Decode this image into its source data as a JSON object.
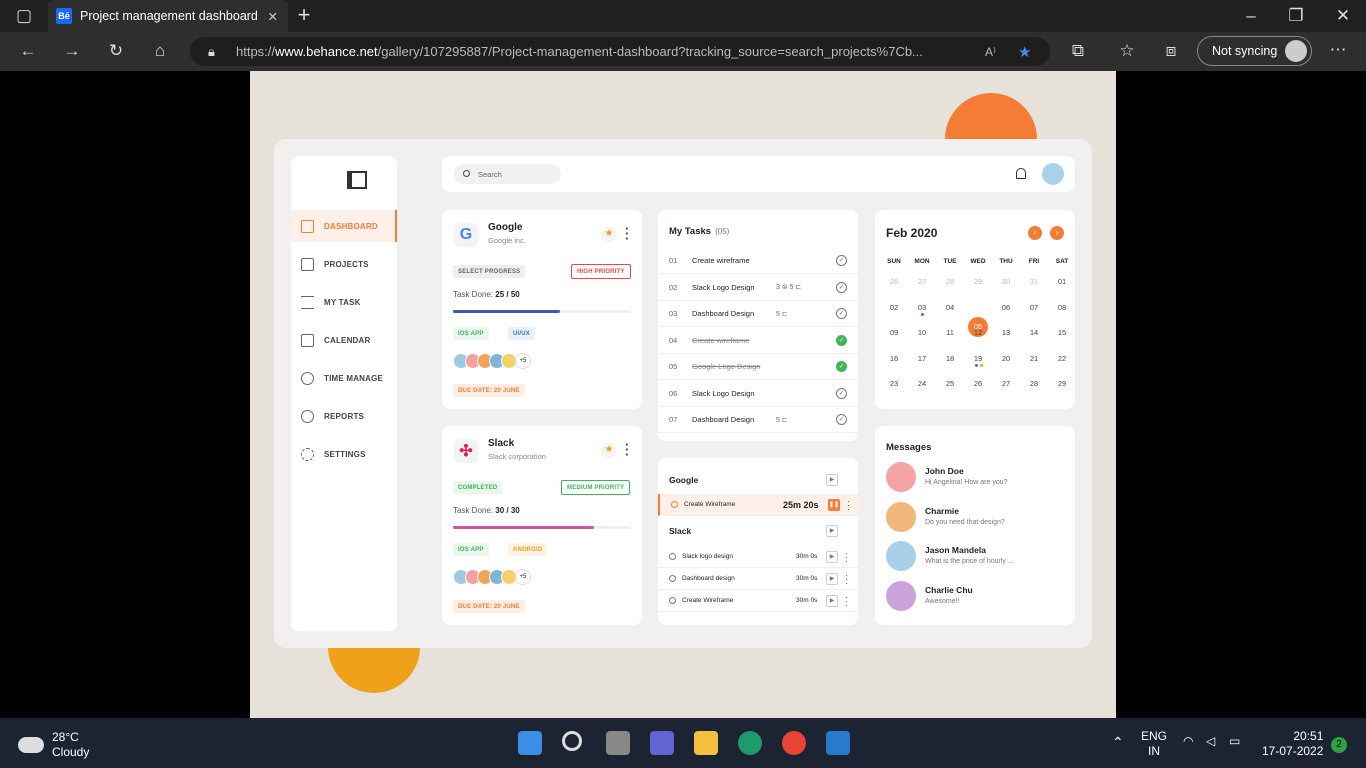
{
  "browser": {
    "tab_title": "Project management dashboard",
    "tab_icon": "Bē",
    "url_prefix": "https://",
    "url_domain": "www.behance.net",
    "url_rest": "/gallery/107295887/Project-management-dashboard?tracking_source=search_projects%7Cb...",
    "sync_label": "Not syncing"
  },
  "sidebar": {
    "items": [
      {
        "label": "DASHBOARD",
        "active": true
      },
      {
        "label": "PROJECTS"
      },
      {
        "label": "MY TASK"
      },
      {
        "label": "CALENDAR"
      },
      {
        "label": "TIME MANAGE"
      },
      {
        "label": "REPORTS"
      },
      {
        "label": "SETTINGS"
      }
    ]
  },
  "topbar": {
    "search_placeholder": "Search"
  },
  "projects": [
    {
      "name": "Google",
      "company": "Google inc.",
      "status": "SELECT PROGRESS",
      "priority": "HIGH PRIORITY",
      "task_done_label": "Task Done:",
      "task_done": "25 / 50",
      "progress": 0.6,
      "tags": [
        "IOS APP",
        "UI/UX"
      ],
      "more": "+5",
      "due": "DUE DATE: 20 JUNE"
    },
    {
      "name": "Slack",
      "company": "Slack corporation",
      "status": "COMPLETED",
      "priority": "MEDIUM PRIORITY",
      "task_done_label": "Task Done:",
      "task_done": "30 / 30",
      "progress": 0.79,
      "tags": [
        "IOS APP",
        "ANDROID"
      ],
      "more": "+5",
      "due": "DUE DATE: 20 JUNE"
    }
  ],
  "my_tasks": {
    "title": "My Tasks",
    "count": "(05)",
    "rows": [
      {
        "num": "01",
        "title": "Create wireframe",
        "meta": "",
        "done": false
      },
      {
        "num": "02",
        "title": "Slack Logo Design",
        "meta": "3 ⊜   5 ⊏",
        "done": false
      },
      {
        "num": "03",
        "title": "Dashboard Design",
        "meta": "5 ⊏",
        "done": false
      },
      {
        "num": "04",
        "title": "Create wireframe",
        "meta": "",
        "done": true
      },
      {
        "num": "05",
        "title": "Google Logo Design",
        "meta": "",
        "done": true
      },
      {
        "num": "06",
        "title": "Slack Logo Design",
        "meta": "",
        "done": false
      },
      {
        "num": "07",
        "title": "Dashboard Design",
        "meta": "5 ⊏",
        "done": false
      }
    ]
  },
  "timer": {
    "group1": "Google",
    "active_task": "Create Wireframe",
    "active_time": "25m 20s",
    "group2": "Slack",
    "rows": [
      {
        "title": "Slack logo design",
        "time": "30m 0s"
      },
      {
        "title": "Dashboard design",
        "time": "30m 0s"
      },
      {
        "title": "Create Wireframe",
        "time": "30m 0s"
      }
    ]
  },
  "calendar": {
    "month": "Feb 2020",
    "weekdays": [
      "SUN",
      "MON",
      "TUE",
      "WED",
      "THU",
      "FRI",
      "SAT"
    ],
    "weeks": [
      [
        "26",
        "27",
        "28",
        "29",
        "30",
        "31",
        "01"
      ],
      [
        "02",
        "03",
        "04",
        "05",
        "06",
        "07",
        "08"
      ],
      [
        "09",
        "10",
        "11",
        "12",
        "13",
        "14",
        "15"
      ],
      [
        "16",
        "17",
        "18",
        "19",
        "20",
        "21",
        "22"
      ],
      [
        "23",
        "24",
        "25",
        "26",
        "27",
        "28",
        "29"
      ]
    ],
    "selected": "05"
  },
  "messages": {
    "title": "Messages",
    "items": [
      {
        "name": "John Doe",
        "text": "Hi Angelina! How are you?",
        "color": "#f5a3a3"
      },
      {
        "name": "Charmie",
        "text": "Do you need that design?",
        "color": "#f0b77a"
      },
      {
        "name": "Jason Mandela",
        "text": "What is the price of hourly ...",
        "color": "#a8d0e6"
      },
      {
        "name": "Charlie Chu",
        "text": "Awesome!!",
        "color": "#c9a3d9"
      }
    ]
  },
  "taskbar": {
    "temperature": "28°C",
    "weather": "Cloudy",
    "lang1": "ENG",
    "lang2": "IN",
    "time": "20:51",
    "date": "17-07-2022",
    "notifications": "2"
  },
  "colors": {
    "accent": "#f47c35",
    "blue_progress": "#4354b8",
    "pink_progress": "#d252a0",
    "green": "#3db55b"
  }
}
